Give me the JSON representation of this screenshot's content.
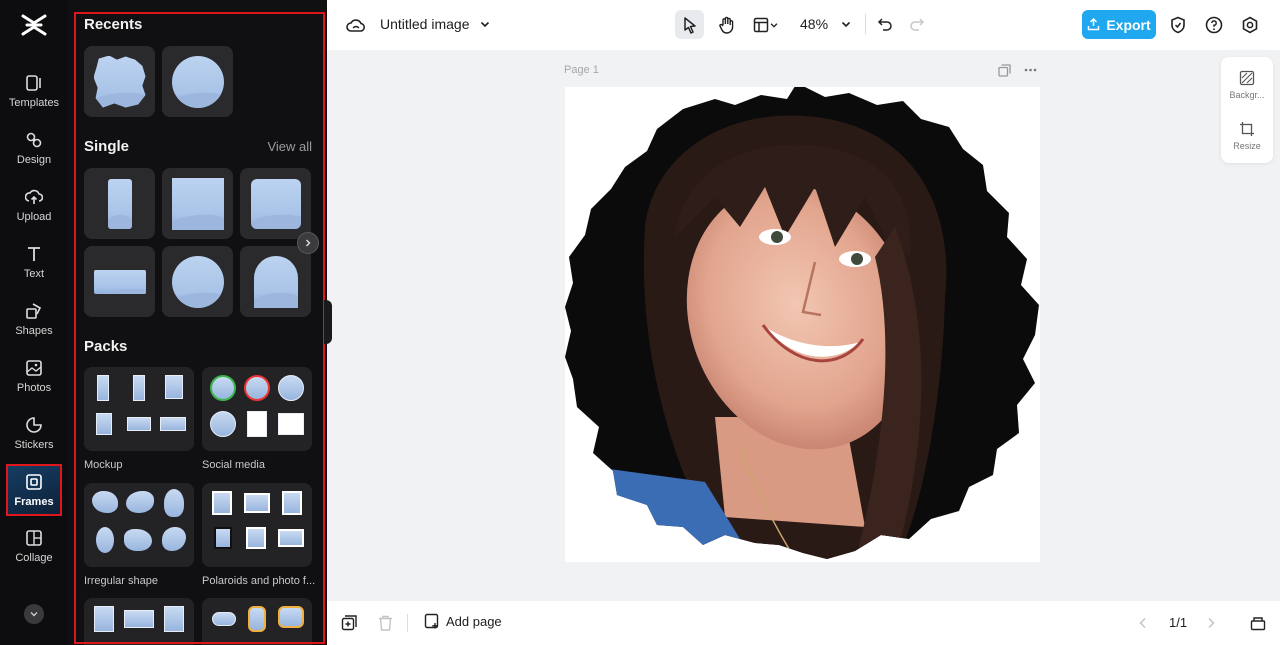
{
  "rail": {
    "items": [
      {
        "label": "Templates",
        "icon": "templates-icon"
      },
      {
        "label": "Design",
        "icon": "design-icon"
      },
      {
        "label": "Upload",
        "icon": "upload-icon"
      },
      {
        "label": "Text",
        "icon": "text-icon"
      },
      {
        "label": "Shapes",
        "icon": "shapes-icon"
      },
      {
        "label": "Photos",
        "icon": "photos-icon"
      },
      {
        "label": "Stickers",
        "icon": "stickers-icon"
      },
      {
        "label": "Frames",
        "icon": "frames-icon",
        "active": true
      },
      {
        "label": "Collage",
        "icon": "collage-icon"
      }
    ]
  },
  "panel": {
    "recents_title": "Recents",
    "single_title": "Single",
    "view_all": "View all",
    "packs_title": "Packs",
    "packs": [
      {
        "label": "Mockup"
      },
      {
        "label": "Social media"
      },
      {
        "label": "Irregular shape"
      },
      {
        "label": "Polaroids and photo f..."
      }
    ]
  },
  "topbar": {
    "title": "Untitled image",
    "zoom": "48%",
    "export_label": "Export"
  },
  "canvas": {
    "page_label": "Page 1"
  },
  "right_tools": {
    "background_label": "Backgr...",
    "resize_label": "Resize"
  },
  "bottombar": {
    "add_page_label": "Add page",
    "page_count": "1/1"
  },
  "colors": {
    "accent": "#1fa8f0",
    "highlight": "#e0161c",
    "rail_bg": "#0d0d0f",
    "panel_bg": "#101012"
  }
}
